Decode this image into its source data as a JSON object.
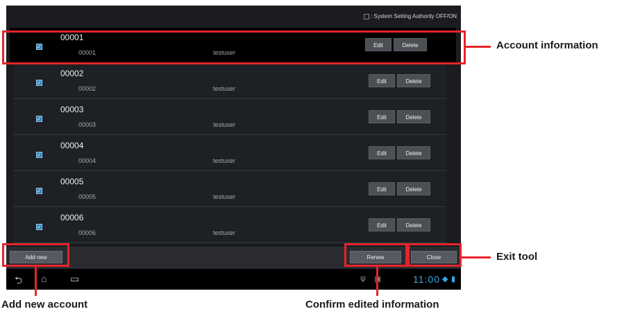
{
  "header": {
    "legend_text": ": System Setting Authority OFF/ON"
  },
  "accounts": [
    {
      "id": "00001",
      "sub_id": "00001",
      "user": "testuser",
      "checked": true
    },
    {
      "id": "00002",
      "sub_id": "00002",
      "user": "testuser",
      "checked": true
    },
    {
      "id": "00003",
      "sub_id": "00003",
      "user": "testuser",
      "checked": true
    },
    {
      "id": "00004",
      "sub_id": "00004",
      "user": "testuser",
      "checked": true
    },
    {
      "id": "00005",
      "sub_id": "00005",
      "user": "testuser",
      "checked": true
    },
    {
      "id": "00006",
      "sub_id": "00006",
      "user": "testuser",
      "checked": true
    }
  ],
  "row_buttons": {
    "edit_label": "Edit",
    "delete_label": "Delete"
  },
  "bottom": {
    "add_new_label": "Add new",
    "renew_label": "Renew",
    "close_label": "Close"
  },
  "system_bar": {
    "clock": "11:00"
  },
  "callouts": {
    "account_information": "Account information",
    "exit_tool": "Exit tool",
    "add_new_account": "Add new account",
    "confirm_edited": "Confirm edited information"
  },
  "colors": {
    "highlight": "#e8232b",
    "accent": "#2c84c7",
    "clock": "#37a7e6"
  }
}
